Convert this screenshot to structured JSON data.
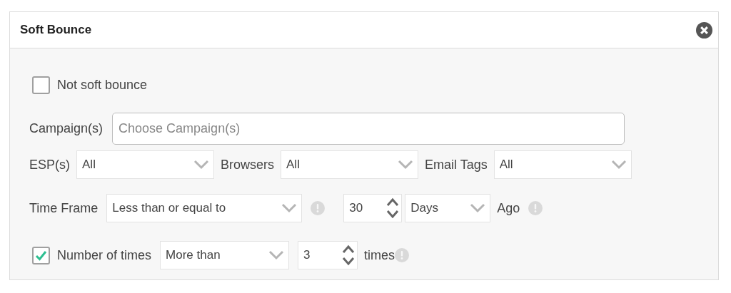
{
  "panel": {
    "title": "Soft Bounce"
  },
  "not_soft_bounce": {
    "label": "Not soft bounce",
    "checked": false
  },
  "campaigns": {
    "label": "Campaign(s)",
    "placeholder": "Choose Campaign(s)"
  },
  "filters": [
    {
      "label": "ESP(s)",
      "value": "All"
    },
    {
      "label": "Browsers",
      "value": "All"
    },
    {
      "label": "Email Tags",
      "value": "All"
    }
  ],
  "time_frame": {
    "label": "Time Frame",
    "operator": "Less than or equal to",
    "amount": "30",
    "unit": "Days",
    "suffix": "Ago"
  },
  "number_of_times": {
    "label": "Number of times",
    "checked": true,
    "operator": "More than",
    "amount": "3",
    "suffix": "times"
  }
}
